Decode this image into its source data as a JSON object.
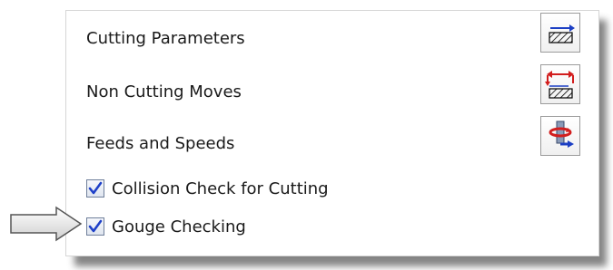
{
  "panel": {
    "rows": {
      "cutting_parameters": "Cutting Parameters",
      "non_cutting_moves": "Non Cutting Moves",
      "feeds_and_speeds": "Feeds and Speeds"
    },
    "checks": {
      "collision": {
        "label": "Collision Check for Cutting",
        "checked": true
      },
      "gouge": {
        "label": "Gouge Checking",
        "checked": true
      }
    },
    "icons": {
      "cutting": "cutting-parameters-icon",
      "noncutting": "non-cutting-moves-icon",
      "feeds": "feeds-speeds-icon",
      "pointer": "pointer-arrow-icon"
    },
    "colors": {
      "check": "#1e40c8",
      "icon_blue": "#1c3fc4",
      "icon_red": "#d21e1e"
    }
  }
}
